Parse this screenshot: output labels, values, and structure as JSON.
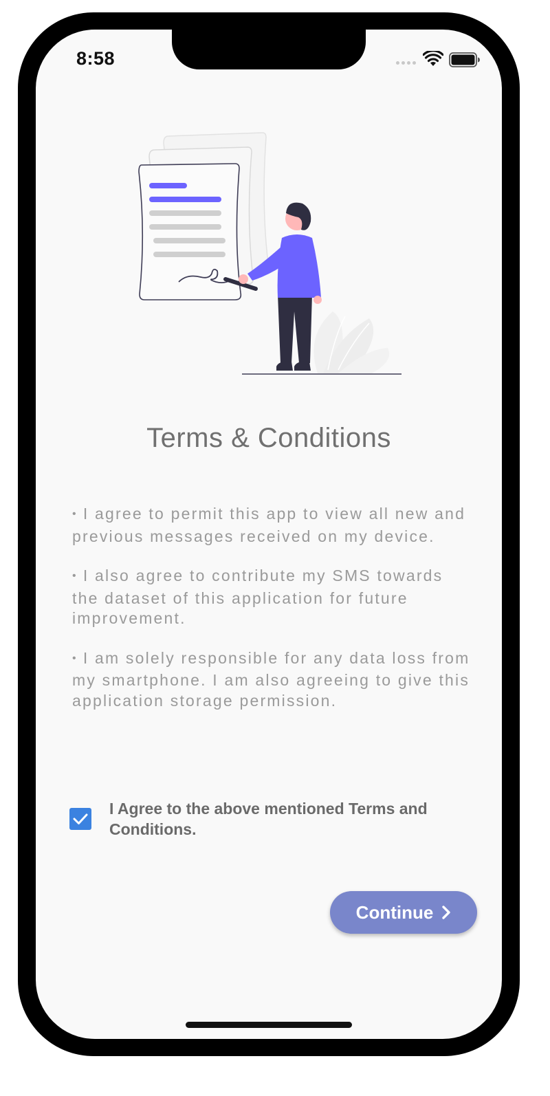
{
  "status_bar": {
    "time": "8:58",
    "wifi_icon": "wifi-icon",
    "battery_icon": "battery-icon"
  },
  "illustration": {
    "icon": "signing-document-illustration",
    "colors": {
      "accent": "#6c63ff",
      "figure_dark": "#2f2e41",
      "skin": "#ffb8b8",
      "lines_gray": "#cfcfcf"
    }
  },
  "page": {
    "title": "Terms & Conditions",
    "bullet": "•",
    "terms": [
      "I agree to permit this app to view all new and previous messages received on my device.",
      "I also agree to contribute my SMS towards the dataset of this application for future improvement.",
      "I am solely responsible for any data loss from my smartphone. I am also agreeing to give this application storage permission."
    ],
    "agree_label": "I Agree to the above mentioned Terms and Conditions.",
    "agree_checked": true,
    "continue_label": "Continue"
  },
  "colors": {
    "checkbox": "#3b82e0",
    "button": "#7986cb",
    "title_text": "#707070",
    "body_text": "#9a9a9a"
  }
}
